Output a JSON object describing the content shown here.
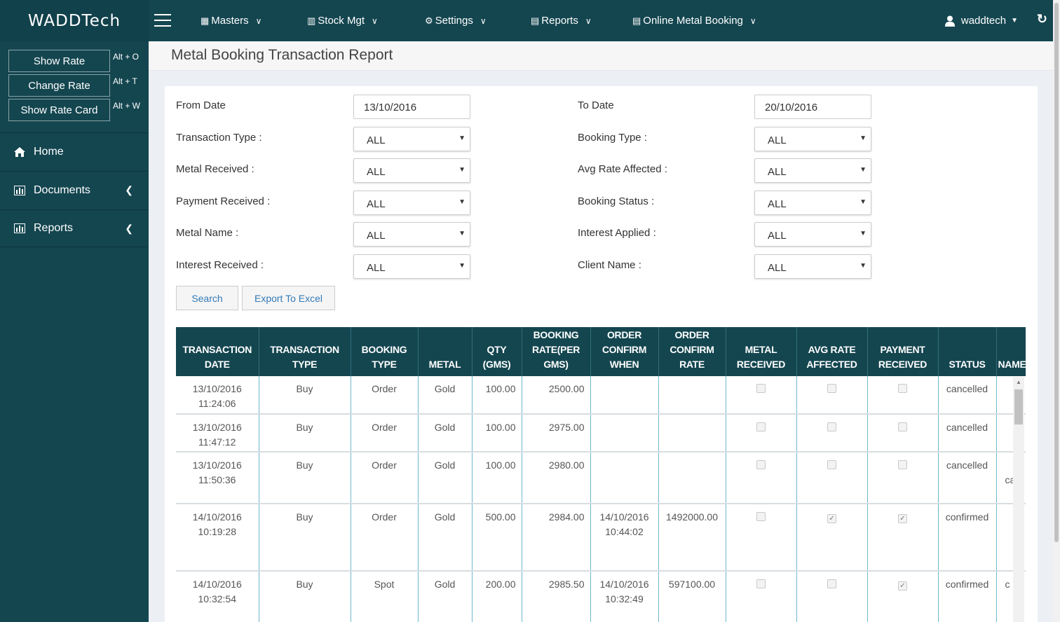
{
  "app": {
    "logo": "WADDTech"
  },
  "rate_buttons": [
    {
      "label": "Show Rate",
      "shortcut": "Alt + O"
    },
    {
      "label": "Change Rate",
      "shortcut": "Alt + T"
    },
    {
      "label": "Show Rate Card",
      "shortcut": "Alt + W"
    }
  ],
  "sidebar": {
    "items": [
      {
        "label": "Home",
        "icon": "home-icon"
      },
      {
        "label": "Documents",
        "icon": "bar-chart-icon"
      },
      {
        "label": "Reports",
        "icon": "bar-chart-icon"
      }
    ]
  },
  "topnav": {
    "menus": [
      {
        "label": "Masters",
        "icon": "grid-icon"
      },
      {
        "label": "Stock Mgt",
        "icon": "bar-chart-icon"
      },
      {
        "label": "Settings",
        "icon": "gear-icon"
      },
      {
        "label": "Reports",
        "icon": "document-icon"
      },
      {
        "label": "Online Metal Booking",
        "icon": "document-icon"
      }
    ],
    "user": "waddtech"
  },
  "page": {
    "title": "Metal Booking Transaction Report"
  },
  "filters": {
    "from_date_label": "From Date",
    "from_date_value": "13/10/2016",
    "to_date_label": "To Date",
    "to_date_value": "20/10/2016",
    "transaction_type_label": "Transaction Type :",
    "transaction_type_value": "ALL",
    "booking_type_label": "Booking Type :",
    "booking_type_value": "ALL",
    "metal_received_label": "Metal Received :",
    "metal_received_value": "ALL",
    "avg_rate_affected_label": "Avg Rate Affected :",
    "avg_rate_affected_value": "ALL",
    "payment_received_label": "Payment Received :",
    "payment_received_value": "ALL",
    "booking_status_label": "Booking Status :",
    "booking_status_value": "ALL",
    "metal_name_label": "Metal Name :",
    "metal_name_value": "ALL",
    "interest_applied_label": "Interest Applied :",
    "interest_applied_value": "ALL",
    "interest_received_label": "Interest Received :",
    "interest_received_value": "ALL",
    "client_name_label": "Client Name :",
    "client_name_value": "ALL"
  },
  "actions": {
    "search": "Search",
    "export": "Export To Excel"
  },
  "table": {
    "headers": [
      [
        "TRANSACTION",
        "DATE"
      ],
      [
        "TRANSACTION",
        "TYPE"
      ],
      [
        "BOOKING",
        "TYPE"
      ],
      [
        "METAL"
      ],
      [
        "QTY",
        "(GMS)"
      ],
      [
        "BOOKING",
        "RATE(PER",
        "GMS)"
      ],
      [
        "ORDER",
        "CONFIRM",
        "WHEN"
      ],
      [
        "ORDER",
        "CONFIRM",
        "RATE"
      ],
      [
        "METAL",
        "RECEIVED"
      ],
      [
        "AVG RATE",
        "AFFECTED"
      ],
      [
        "PAYMENT",
        "RECEIVED"
      ],
      [
        "STATUS"
      ],
      [
        "NAME"
      ]
    ],
    "rows": [
      {
        "date": "13/10/2016",
        "time": "11:24:06",
        "type": "Buy",
        "booking": "Order",
        "metal": "Gold",
        "qty": "100.00",
        "rate": "2500.00",
        "confirm_date": "",
        "confirm_time": "",
        "confirm_rate": "",
        "metal_received": false,
        "avg_rate": false,
        "payment": false,
        "status": "cancelled",
        "name": "",
        "height": 54
      },
      {
        "date": "13/10/2016",
        "time": "11:47:12",
        "type": "Buy",
        "booking": "Order",
        "metal": "Gold",
        "qty": "100.00",
        "rate": "2975.00",
        "confirm_date": "",
        "confirm_time": "",
        "confirm_rate": "",
        "metal_received": false,
        "avg_rate": false,
        "payment": false,
        "status": "cancelled",
        "name": "",
        "height": 54
      },
      {
        "date": "13/10/2016",
        "time": "11:50:36",
        "type": "Buy",
        "booking": "Order",
        "metal": "Gold",
        "qty": "100.00",
        "rate": "2980.00",
        "confirm_date": "",
        "confirm_time": "",
        "confirm_rate": "",
        "metal_received": false,
        "avg_rate": false,
        "payment": false,
        "status": "cancelled",
        "name": "ca",
        "height": 74
      },
      {
        "date": "14/10/2016",
        "time": "10:19:28",
        "type": "Buy",
        "booking": "Order",
        "metal": "Gold",
        "qty": "500.00",
        "rate": "2984.00",
        "confirm_date": "14/10/2016",
        "confirm_time": "10:44:02",
        "confirm_rate": "1492000.00",
        "metal_received": false,
        "avg_rate": true,
        "payment": true,
        "status": "confirmed",
        "name": "",
        "height": 96
      },
      {
        "date": "14/10/2016",
        "time": "10:32:54",
        "type": "Buy",
        "booking": "Spot",
        "metal": "Gold",
        "qty": "200.00",
        "rate": "2985.50",
        "confirm_date": "14/10/2016",
        "confirm_time": "10:32:49",
        "confirm_rate": "597100.00",
        "metal_received": false,
        "avg_rate": false,
        "payment": true,
        "status": "confirmed",
        "name": "c",
        "height": 80
      }
    ]
  }
}
